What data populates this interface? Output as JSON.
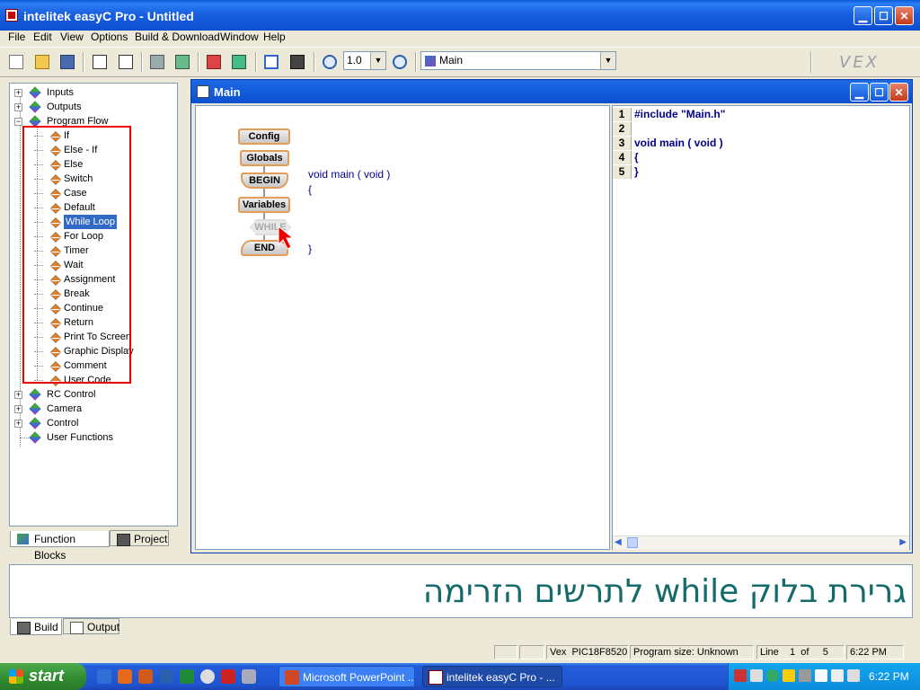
{
  "window": {
    "title": "intelitek easyC Pro - Untitled"
  },
  "menu": [
    "File",
    "Edit",
    "View",
    "Options",
    "Build & Download",
    "Window",
    "Help"
  ],
  "toolbar": {
    "zoom_value": "1.0",
    "function_select": "Main",
    "brand_logo": "VEX"
  },
  "tree": {
    "top": [
      {
        "label": "Inputs",
        "expander": "+"
      },
      {
        "label": "Outputs",
        "expander": "+"
      },
      {
        "label": "Program Flow",
        "expander": "−"
      }
    ],
    "program_flow_children": [
      "If",
      "Else - If",
      "Else",
      "Switch",
      "Case",
      "Default",
      "While Loop",
      "For Loop",
      "Timer",
      "Wait",
      "Assignment",
      "Break",
      "Continue",
      "Return",
      "Print To Screen",
      "Graphic Display",
      "Comment",
      "User Code"
    ],
    "selected": "While Loop",
    "bottom": [
      {
        "label": "RC Control",
        "expander": "+"
      },
      {
        "label": "Camera",
        "expander": "+"
      },
      {
        "label": "Control",
        "expander": "+"
      },
      {
        "label": "User Functions",
        "expander": ""
      }
    ]
  },
  "left_tabs": {
    "function_blocks": "Function Blocks",
    "project": "Project"
  },
  "mdi": {
    "title": "Main"
  },
  "flow_blocks": {
    "config": "Config",
    "globals": "Globals",
    "begin": "BEGIN",
    "variables": "Variables",
    "while": "WHILE",
    "end": "END"
  },
  "flow_code": {
    "signature": "void main ( void )",
    "open_brace": "{",
    "close_brace": "}"
  },
  "source_lines": [
    {
      "num": "1",
      "text": "#include \"Main.h\""
    },
    {
      "num": "2",
      "text": ""
    },
    {
      "num": "3",
      "text": "void main ( void )"
    },
    {
      "num": "4",
      "text": "{"
    },
    {
      "num": "5",
      "text": "}"
    }
  ],
  "caption": "גרירת בלוק while לתרשים הזרימה",
  "bottom_tabs": {
    "build": "Build",
    "output": "Output"
  },
  "status": {
    "target": "Vex  PIC18F8520",
    "program_size": "Program size: Unknown",
    "line": "Line    1  of     5",
    "time": "6:22 PM"
  },
  "taskbar": {
    "start": "start",
    "tasks": [
      "Microsoft PowerPoint ...",
      "intelitek easyC Pro - ..."
    ],
    "clock": "6:22 PM"
  },
  "colors": {
    "accent": "#0c4fd0",
    "highlight_box": "#ee0000",
    "caption": "#156a6a",
    "code": "#00008b",
    "selection": "#316ac5"
  }
}
